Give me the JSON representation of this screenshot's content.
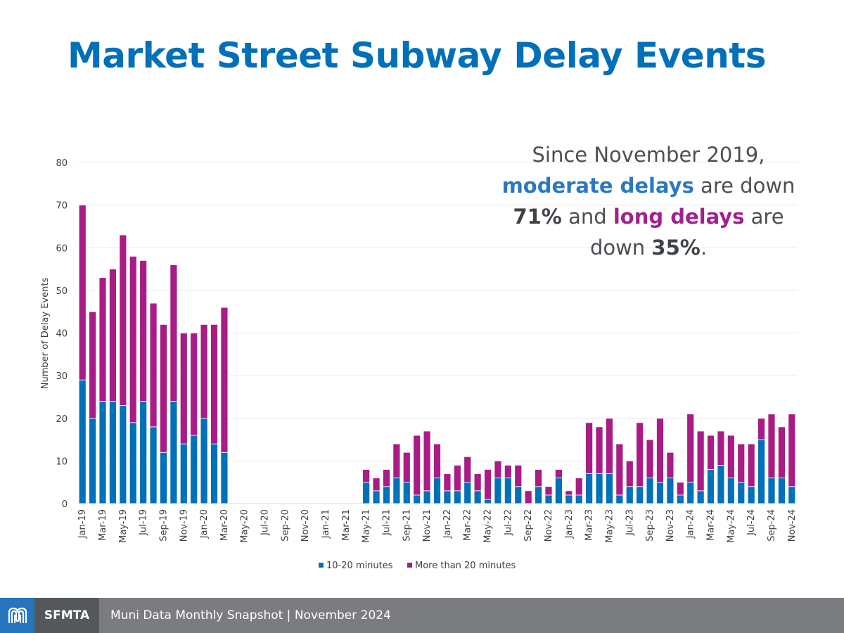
{
  "page": {
    "title": "Market Street Subway Delay Events"
  },
  "annotation": {
    "line1": "Since November 2019,",
    "moderate": "moderate delays",
    "are_down_1": " are down",
    "pct_moderate": "71%",
    "and": " and ",
    "long": "long delays",
    "are_2": " are",
    "down_2": "down ",
    "pct_long": "35%",
    "period": "."
  },
  "footer": {
    "brand": "SFMTA",
    "logo_icon": "muni-worm-logo-icon",
    "text": "Muni Data Monthly Snapshot | November 2024"
  },
  "colors": {
    "moderate": "#0070b8",
    "long": "#a91c85",
    "title": "#0070b8"
  },
  "chart_data": {
    "type": "bar",
    "stacked": true,
    "title": "Market Street Subway Delay Events",
    "xlabel": "",
    "ylabel": "Number of Delay Events",
    "ylim": [
      0,
      80
    ],
    "yticks": [
      0,
      10,
      20,
      30,
      40,
      50,
      60,
      70,
      80
    ],
    "grid": true,
    "legend_position": "bottom",
    "categories": [
      "Jan-19",
      "Feb-19",
      "Mar-19",
      "Apr-19",
      "May-19",
      "Jun-19",
      "Jul-19",
      "Aug-19",
      "Sep-19",
      "Oct-19",
      "Nov-19",
      "Dec-19",
      "Jan-20",
      "Feb-20",
      "Mar-20",
      "Apr-20",
      "May-20",
      "Jun-20",
      "Jul-20",
      "Aug-20",
      "Sep-20",
      "Oct-20",
      "Nov-20",
      "Dec-20",
      "Jan-21",
      "Feb-21",
      "Mar-21",
      "Apr-21",
      "May-21",
      "Jun-21",
      "Jul-21",
      "Aug-21",
      "Sep-21",
      "Oct-21",
      "Nov-21",
      "Dec-21",
      "Jan-22",
      "Feb-22",
      "Mar-22",
      "Apr-22",
      "May-22",
      "Jun-22",
      "Jul-22",
      "Aug-22",
      "Sep-22",
      "Oct-22",
      "Nov-22",
      "Dec-22",
      "Jan-23",
      "Feb-23",
      "Mar-23",
      "Apr-23",
      "May-23",
      "Jun-23",
      "Jul-23",
      "Aug-23",
      "Sep-23",
      "Oct-23",
      "Nov-23",
      "Dec-23",
      "Jan-24",
      "Feb-24",
      "Mar-24",
      "Apr-24",
      "May-24",
      "Jun-24",
      "Jul-24",
      "Aug-24",
      "Sep-24",
      "Oct-24",
      "Nov-24"
    ],
    "tick_labels": [
      "Jan-19",
      "Mar-19",
      "May-19",
      "Jul-19",
      "Sep-19",
      "Nov-19",
      "Jan-20",
      "Mar-20",
      "May-20",
      "Jul-20",
      "Sep-20",
      "Nov-20",
      "Jan-21",
      "Mar-21",
      "May-21",
      "Jul-21",
      "Sep-21",
      "Nov-21",
      "Jan-22",
      "Mar-22",
      "May-22",
      "Jul-22",
      "Sep-22",
      "Nov-22",
      "Jan-23",
      "Mar-23",
      "May-23",
      "Jul-23",
      "Sep-23",
      "Nov-23",
      "Jan-24",
      "Mar-24",
      "May-24",
      "Jul-24",
      "Sep-24",
      "Nov-24"
    ],
    "series": [
      {
        "name": "10-20 minutes",
        "color": "#0070b8",
        "values": [
          29,
          20,
          24,
          24,
          23,
          19,
          24,
          18,
          12,
          24,
          14,
          16,
          20,
          14,
          12,
          null,
          null,
          null,
          null,
          null,
          null,
          null,
          null,
          null,
          null,
          null,
          null,
          null,
          5,
          3,
          4,
          6,
          5,
          2,
          3,
          6,
          3,
          3,
          5,
          3,
          1,
          6,
          6,
          4,
          0,
          4,
          2,
          6,
          2,
          2,
          7,
          7,
          7,
          2,
          4,
          4,
          6,
          5,
          6,
          2,
          5,
          3,
          8,
          9,
          6,
          5,
          4,
          15,
          6,
          6,
          4
        ]
      },
      {
        "name": "More than 20 minutes",
        "color": "#a91c85",
        "values": [
          41,
          25,
          29,
          31,
          40,
          39,
          33,
          29,
          30,
          32,
          26,
          24,
          22,
          28,
          34,
          null,
          null,
          null,
          null,
          null,
          null,
          null,
          null,
          null,
          null,
          null,
          null,
          null,
          3,
          3,
          4,
          8,
          7,
          14,
          14,
          8,
          4,
          6,
          6,
          4,
          7,
          4,
          3,
          5,
          3,
          4,
          2,
          2,
          1,
          4,
          12,
          11,
          13,
          12,
          6,
          15,
          9,
          15,
          6,
          3,
          16,
          14,
          8,
          8,
          10,
          9,
          10,
          5,
          15,
          12,
          17
        ]
      }
    ]
  }
}
